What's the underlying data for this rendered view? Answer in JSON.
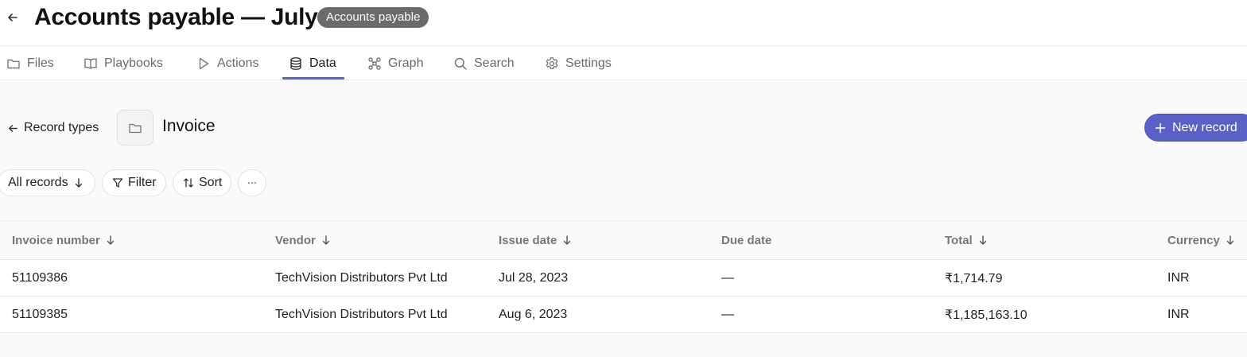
{
  "header": {
    "title": "Accounts payable — July",
    "badge": "Accounts payable"
  },
  "tabs": [
    {
      "label": "Files",
      "icon": "folder-icon"
    },
    {
      "label": "Playbooks",
      "icon": "book-icon"
    },
    {
      "label": "Actions",
      "icon": "play-icon"
    },
    {
      "label": "Data",
      "icon": "database-icon",
      "active": true
    },
    {
      "label": "Graph",
      "icon": "graph-icon"
    },
    {
      "label": "Search",
      "icon": "search-icon"
    },
    {
      "label": "Settings",
      "icon": "gear-icon"
    }
  ],
  "record": {
    "back_label": "Record types",
    "title": "Invoice",
    "new_button": "New record"
  },
  "toolbar": {
    "view_label": "All records",
    "filter_label": "Filter",
    "sort_label": "Sort",
    "more_label": "···"
  },
  "table": {
    "columns": [
      {
        "label": "Invoice number",
        "sortable": true
      },
      {
        "label": "Vendor",
        "sortable": true
      },
      {
        "label": "Issue date",
        "sortable": true
      },
      {
        "label": "Due date",
        "sortable": false
      },
      {
        "label": "Total",
        "sortable": true
      },
      {
        "label": "Currency",
        "sortable": true
      }
    ],
    "rows": [
      [
        "51109386",
        "TechVision Distributors Pvt Ltd",
        "Jul 28, 2023",
        "—",
        "₹1,714.79",
        "INR"
      ],
      [
        "51109385",
        "TechVision Distributors Pvt Ltd",
        "Aug 6, 2023",
        "—",
        "₹1,185,163.10",
        "INR"
      ]
    ]
  },
  "colors": {
    "accent": "#5a61c6",
    "badge": "#6b6b6b"
  }
}
